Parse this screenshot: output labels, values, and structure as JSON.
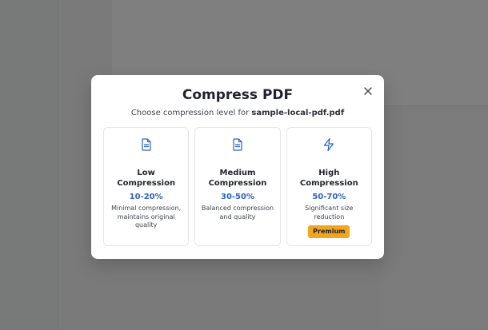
{
  "dialog": {
    "title": "Compress PDF",
    "subtitle_prefix": "Choose compression level for",
    "filename": "sample-local-pdf.pdf",
    "close_icon": "close-icon"
  },
  "options": [
    {
      "name_line1": "Low",
      "name_line2": "Compression",
      "range": "10-20%",
      "description": "Minimal compression, maintains original quality",
      "icon": "document-icon"
    },
    {
      "name_line1": "Medium",
      "name_line2": "Compression",
      "range": "30-50%",
      "description": "Balanced compression and quality",
      "icon": "document-icon"
    },
    {
      "name_line1": "High",
      "name_line2": "Compression",
      "range": "50-70%",
      "description": "Significant size reduction",
      "badge": "Premium",
      "icon": "lightning-icon"
    }
  ],
  "colors": {
    "accent": "#2b62c0",
    "badge": "#f2a51f",
    "overlay": "rgba(0,0,0,0.5)"
  }
}
